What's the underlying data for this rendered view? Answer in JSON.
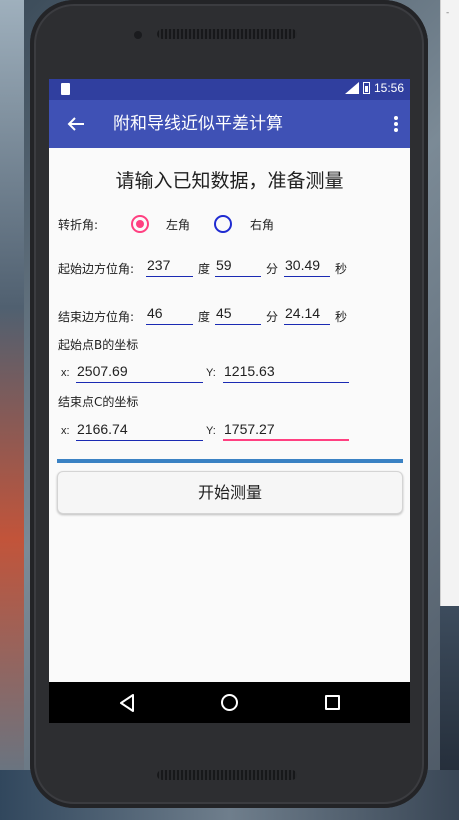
{
  "status_bar": {
    "time": "15:56",
    "icons": [
      "sd-card-icon",
      "signal-icon",
      "battery-icon"
    ]
  },
  "toolbar": {
    "title": "附和导线近似平差计算",
    "back_icon": "arrow-left-icon",
    "menu_icon": "more-vertical-icon",
    "background": "#3f51b5",
    "status_background": "#303f9f"
  },
  "form": {
    "heading": "请输入已知数据，准备测量",
    "turning_angle": {
      "label": "转折角:",
      "options": [
        {
          "label": "左角",
          "checked": true
        },
        {
          "label": "右角",
          "checked": false
        }
      ]
    },
    "start_azimuth": {
      "label": "起始边方位角:",
      "degrees": "237",
      "degree_unit": "度",
      "minutes": "59",
      "minute_unit": "分",
      "seconds": "30.49",
      "second_unit": "秒"
    },
    "end_azimuth": {
      "label": "结束边方位角:",
      "degrees": "46",
      "degree_unit": "度",
      "minutes": "45",
      "minute_unit": "分",
      "seconds": "24.14",
      "second_unit": "秒"
    },
    "point_b": {
      "label": "起始点B的坐标",
      "x_label": "x:",
      "x_value": "2507.69",
      "y_label": "Y:",
      "y_value": "1215.63"
    },
    "point_c": {
      "label": "结束点C的坐标",
      "x_label": "x:",
      "x_value": "2166.74",
      "y_label": "Y:",
      "y_value": "1757.27"
    },
    "start_button": "开始测量"
  },
  "colors": {
    "accent": "#ff4081",
    "input_underline": "#1a2ab3",
    "divider": "#3b82c4"
  }
}
